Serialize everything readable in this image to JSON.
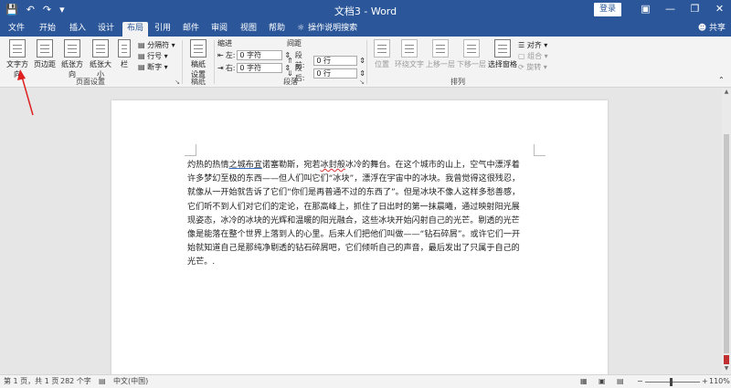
{
  "titlebar": {
    "qat": [
      "save-icon",
      "undo-icon",
      "redo-icon",
      "customize-icon"
    ],
    "title": "文档3  -  Word",
    "login": "登录",
    "controls": [
      "ribbon-display-icon",
      "minimize-icon",
      "maximize-icon",
      "close-icon"
    ]
  },
  "tabs": [
    "文件",
    "开始",
    "插入",
    "设计",
    "布局",
    "引用",
    "邮件",
    "审阅",
    "视图",
    "帮助"
  ],
  "active_tab": "布局",
  "tellme": "操作说明搜索",
  "share": "共享",
  "ribbon": {
    "page_setup": {
      "label": "页面设置",
      "text_direction": "文字方向",
      "margins": "页边距",
      "orientation": "纸张方向",
      "size": "纸张大小",
      "columns": "栏",
      "breaks": "分隔符",
      "line_numbers": "行号",
      "hyphenation": "断字"
    },
    "draft": {
      "label": "稿纸",
      "draft_settings_1": "稿纸",
      "draft_settings_2": "设置"
    },
    "paragraph": {
      "label": "段落",
      "indent": "缩进",
      "spacing": "间距",
      "left_label": "左:",
      "left_value": "0 字符",
      "right_label": "右:",
      "right_value": "0 字符",
      "before_label": "段前:",
      "before_value": "0 行",
      "after_label": "段后:",
      "after_value": "0 行"
    },
    "arrange": {
      "label": "排列",
      "position": "位置",
      "wrap_text": "环绕文字",
      "bring_forward": "上移一层",
      "send_backward": "下移一层",
      "selection_pane": "选择窗格",
      "align": "对齐",
      "group": "组合",
      "rotate": "旋转"
    }
  },
  "document": {
    "lines": [
      "灼热的热情之城布宜诺塞勒斯，宛若冰封般冰冷的舞台。在这个城市的山上，空气中漂浮着",
      "许多梦幻至极的东西——但人们叫它们“冰块”，漂浮在宇宙中的冰块。我曾觉得这很残忍，",
      "就像从一开始就告诉了它们“你们是再普通不过的东西了”。但是冰块不像人这样多愁善感，",
      "它们听不到人们对它们的定论，在那高峰上，抓住了日出时的第一抹晨曦，通过映射阳光展",
      "现姿态，冰冷的冰块的光辉和温暖的阳光融合，这些冰块开始闪射自己的光芒。剔透的光芒",
      "像是能落在整个世界上落到人的心里。后来人们把他们叫做——“钻石碎屑”。或许它们一开",
      "始就知道自己是那纯净剔透的钻石碎屑吧，它们倾听自己的声音，最后发出了只属于自己的",
      "光芒。."
    ],
    "line1_parts": {
      "a": "灼热的热情",
      "b": "之城布宜",
      "c": "诺塞勒斯，宛若",
      "d": "冰封般",
      "e": "冰冷的舞台。在这个城市的山上，空气中漂浮着"
    }
  },
  "statusbar": {
    "page": "第 1 页，共 1 页",
    "words": "282 个字",
    "language": "中文(中国)",
    "zoom": "110%",
    "zoom_minus": "−",
    "zoom_plus": "+"
  },
  "colors": {
    "brand": "#2b579a",
    "arrow": "#e02020"
  }
}
